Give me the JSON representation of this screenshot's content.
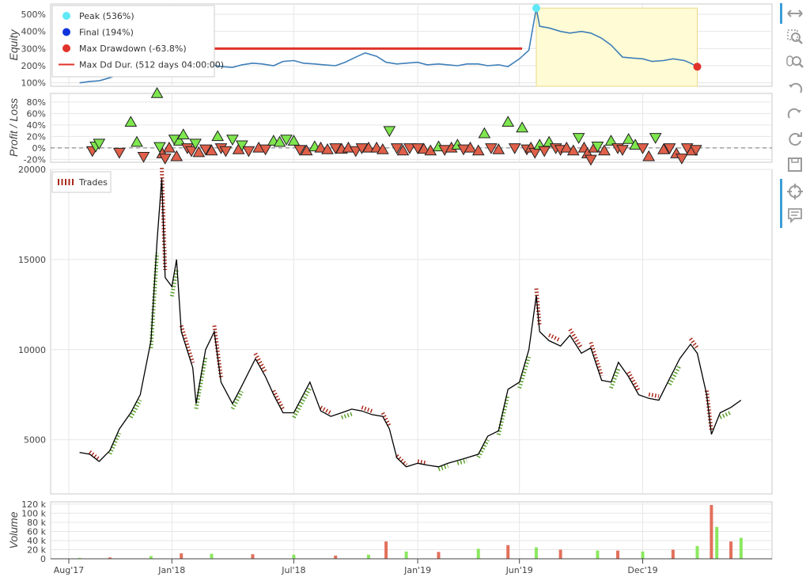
{
  "chart_data": [
    {
      "type": "line",
      "ylabel": "Equity",
      "yticks": [
        "500%",
        "400%",
        "300%",
        "200%",
        "100%"
      ],
      "ylim": [
        80,
        560
      ],
      "legend": [
        {
          "name": "Peak (536%)",
          "color": "#5fe8f5",
          "marker": "circle"
        },
        {
          "name": "Final (194%)",
          "color": "#1133dd",
          "marker": "circle"
        },
        {
          "name": "Max Drawdown (-63.8%)",
          "color": "#e0332b",
          "marker": "circle"
        },
        {
          "name": "Max Dd Dur. (512 days 04:00:00)",
          "color": "#e0332b",
          "marker": "line"
        }
      ],
      "legend_position": "top-left",
      "peak": {
        "date": "2019-06-26",
        "value": 536
      },
      "final": {
        "date": "2020-02-20",
        "value": 194
      },
      "max_drawdown_pct": -63.8,
      "max_dd_duration_level": 300,
      "max_dd_duration_range": [
        "2018-01-08",
        "2019-06-05"
      ],
      "drawdown_box": {
        "from": "2019-06-26",
        "to": "2020-02-20",
        "top": 536
      },
      "x": [
        "2017-08-17",
        "2017-09-01",
        "2017-09-15",
        "2017-10-01",
        "2017-10-15",
        "2017-11-01",
        "2017-11-15",
        "2017-12-01",
        "2017-12-15",
        "2018-01-01",
        "2018-01-15",
        "2018-02-01",
        "2018-02-15",
        "2018-03-01",
        "2018-03-15",
        "2018-04-01",
        "2018-04-15",
        "2018-05-01",
        "2018-05-15",
        "2018-06-01",
        "2018-06-15",
        "2018-07-01",
        "2018-07-15",
        "2018-08-01",
        "2018-08-15",
        "2018-09-01",
        "2018-09-15",
        "2018-10-01",
        "2018-10-15",
        "2018-11-01",
        "2018-11-15",
        "2018-12-01",
        "2018-12-15",
        "2019-01-01",
        "2019-01-15",
        "2019-02-01",
        "2019-02-15",
        "2019-03-01",
        "2019-03-15",
        "2019-04-01",
        "2019-04-15",
        "2019-05-01",
        "2019-05-15",
        "2019-06-01",
        "2019-06-15",
        "2019-06-26",
        "2019-07-01",
        "2019-07-15",
        "2019-08-01",
        "2019-08-15",
        "2019-09-01",
        "2019-09-15",
        "2019-10-01",
        "2019-10-15",
        "2019-11-01",
        "2019-11-15",
        "2019-12-01",
        "2019-12-15",
        "2020-01-01",
        "2020-01-15",
        "2020-02-01",
        "2020-02-10",
        "2020-02-20"
      ],
      "y": [
        100,
        108,
        112,
        130,
        150,
        170,
        180,
        200,
        215,
        225,
        230,
        220,
        200,
        205,
        195,
        190,
        205,
        215,
        210,
        200,
        225,
        230,
        215,
        210,
        205,
        200,
        220,
        250,
        275,
        255,
        220,
        210,
        215,
        220,
        205,
        210,
        205,
        200,
        210,
        210,
        200,
        205,
        195,
        240,
        290,
        536,
        430,
        420,
        400,
        390,
        400,
        390,
        360,
        320,
        250,
        245,
        240,
        225,
        230,
        240,
        230,
        215,
        194
      ]
    },
    {
      "type": "scatter",
      "ylabel": "Profit / Loss",
      "yticks": [
        "80%",
        "60%",
        "40%",
        "20%",
        "0%",
        "-20%"
      ],
      "ylim": [
        -25,
        95
      ],
      "markers": {
        "long": "triangle-up",
        "short": "triangle-down",
        "profit_color": "#7ee64e",
        "loss_color": "#e0604a"
      },
      "trades": [
        {
          "x": "2017-09-05",
          "pnl": -5,
          "dir": "short"
        },
        {
          "x": "2017-09-10",
          "pnl": 3,
          "dir": "short"
        },
        {
          "x": "2017-09-15",
          "pnl": 8,
          "dir": "short"
        },
        {
          "x": "2017-10-15",
          "pnl": -8,
          "dir": "short"
        },
        {
          "x": "2017-11-01",
          "pnl": 45,
          "dir": "long"
        },
        {
          "x": "2017-11-10",
          "pnl": 10,
          "dir": "long"
        },
        {
          "x": "2017-11-20",
          "pnl": -15,
          "dir": "short"
        },
        {
          "x": "2017-12-10",
          "pnl": 95,
          "dir": "long"
        },
        {
          "x": "2017-12-14",
          "pnl": 2,
          "dir": "short"
        },
        {
          "x": "2017-12-18",
          "pnl": -10,
          "dir": "long"
        },
        {
          "x": "2017-12-22",
          "pnl": -18,
          "dir": "short"
        },
        {
          "x": "2017-12-28",
          "pnl": 0,
          "dir": "long"
        },
        {
          "x": "2018-01-05",
          "pnl": 15,
          "dir": "short"
        },
        {
          "x": "2018-01-08",
          "pnl": -15,
          "dir": "long"
        },
        {
          "x": "2018-01-12",
          "pnl": 12,
          "dir": "long"
        },
        {
          "x": "2018-01-18",
          "pnl": 23,
          "dir": "long"
        },
        {
          "x": "2018-01-24",
          "pnl": 0,
          "dir": "short"
        },
        {
          "x": "2018-01-30",
          "pnl": -5,
          "dir": "short"
        },
        {
          "x": "2018-02-05",
          "pnl": 8,
          "dir": "short"
        },
        {
          "x": "2018-02-10",
          "pnl": -8,
          "dir": "long"
        },
        {
          "x": "2018-02-20",
          "pnl": -2,
          "dir": "short"
        },
        {
          "x": "2018-03-01",
          "pnl": -5,
          "dir": "long"
        },
        {
          "x": "2018-03-10",
          "pnl": 20,
          "dir": "long"
        },
        {
          "x": "2018-03-15",
          "pnl": 0,
          "dir": "short"
        },
        {
          "x": "2018-03-22",
          "pnl": -5,
          "dir": "short"
        },
        {
          "x": "2018-04-01",
          "pnl": 15,
          "dir": "short"
        },
        {
          "x": "2018-04-10",
          "pnl": -3,
          "dir": "long"
        },
        {
          "x": "2018-04-15",
          "pnl": 5,
          "dir": "short"
        },
        {
          "x": "2018-04-25",
          "pnl": -5,
          "dir": "short"
        },
        {
          "x": "2018-05-10",
          "pnl": 0,
          "dir": "long"
        },
        {
          "x": "2018-05-20",
          "pnl": -2,
          "dir": "short"
        },
        {
          "x": "2018-06-01",
          "pnl": 12,
          "dir": "long"
        },
        {
          "x": "2018-06-10",
          "pnl": 10,
          "dir": "long"
        },
        {
          "x": "2018-06-20",
          "pnl": 15,
          "dir": "short"
        },
        {
          "x": "2018-07-01",
          "pnl": 12,
          "dir": "long"
        },
        {
          "x": "2018-07-10",
          "pnl": -3,
          "dir": "short"
        },
        {
          "x": "2018-07-20",
          "pnl": -5,
          "dir": "long"
        },
        {
          "x": "2018-08-01",
          "pnl": 2,
          "dir": "long"
        },
        {
          "x": "2018-08-10",
          "pnl": 0,
          "dir": "long"
        },
        {
          "x": "2018-08-20",
          "pnl": -3,
          "dir": "long"
        },
        {
          "x": "2018-09-01",
          "pnl": 0,
          "dir": "short"
        },
        {
          "x": "2018-09-10",
          "pnl": -2,
          "dir": "long"
        },
        {
          "x": "2018-09-20",
          "pnl": 0,
          "dir": "long"
        },
        {
          "x": "2018-10-01",
          "pnl": -5,
          "dir": "short"
        },
        {
          "x": "2018-10-10",
          "pnl": 0,
          "dir": "short"
        },
        {
          "x": "2018-10-20",
          "pnl": 0,
          "dir": "long"
        },
        {
          "x": "2018-11-01",
          "pnl": 0,
          "dir": "long"
        },
        {
          "x": "2018-11-10",
          "pnl": -3,
          "dir": "long"
        },
        {
          "x": "2018-11-20",
          "pnl": 30,
          "dir": "short"
        },
        {
          "x": "2018-12-01",
          "pnl": 0,
          "dir": "short"
        },
        {
          "x": "2018-12-10",
          "pnl": -5,
          "dir": "long"
        },
        {
          "x": "2018-12-20",
          "pnl": 0,
          "dir": "short"
        },
        {
          "x": "2019-01-01",
          "pnl": 0,
          "dir": "short"
        },
        {
          "x": "2019-01-10",
          "pnl": -2,
          "dir": "long"
        },
        {
          "x": "2019-01-20",
          "pnl": -5,
          "dir": "long"
        },
        {
          "x": "2019-02-01",
          "pnl": 2,
          "dir": "long"
        },
        {
          "x": "2019-02-10",
          "pnl": -3,
          "dir": "short"
        },
        {
          "x": "2019-02-20",
          "pnl": 0,
          "dir": "long"
        },
        {
          "x": "2019-03-01",
          "pnl": 5,
          "dir": "long"
        },
        {
          "x": "2019-03-10",
          "pnl": -2,
          "dir": "short"
        },
        {
          "x": "2019-03-20",
          "pnl": 0,
          "dir": "long"
        },
        {
          "x": "2019-04-01",
          "pnl": -5,
          "dir": "long"
        },
        {
          "x": "2019-04-10",
          "pnl": 25,
          "dir": "long"
        },
        {
          "x": "2019-04-20",
          "pnl": 0,
          "dir": "short"
        },
        {
          "x": "2019-05-01",
          "pnl": -3,
          "dir": "long"
        },
        {
          "x": "2019-05-15",
          "pnl": 45,
          "dir": "long"
        },
        {
          "x": "2019-05-25",
          "pnl": 0,
          "dir": "short"
        },
        {
          "x": "2019-06-05",
          "pnl": 35,
          "dir": "long"
        },
        {
          "x": "2019-06-12",
          "pnl": -2,
          "dir": "short"
        },
        {
          "x": "2019-06-18",
          "pnl": 0,
          "dir": "long"
        },
        {
          "x": "2019-06-24",
          "pnl": -8,
          "dir": "short"
        },
        {
          "x": "2019-07-01",
          "pnl": 5,
          "dir": "long"
        },
        {
          "x": "2019-07-08",
          "pnl": -5,
          "dir": "short"
        },
        {
          "x": "2019-07-15",
          "pnl": 10,
          "dir": "long"
        },
        {
          "x": "2019-07-25",
          "pnl": 0,
          "dir": "short"
        },
        {
          "x": "2019-08-01",
          "pnl": -3,
          "dir": "short"
        },
        {
          "x": "2019-08-10",
          "pnl": 0,
          "dir": "long"
        },
        {
          "x": "2019-08-20",
          "pnl": -5,
          "dir": "long"
        },
        {
          "x": "2019-08-28",
          "pnl": 18,
          "dir": "short"
        },
        {
          "x": "2019-09-05",
          "pnl": 0,
          "dir": "long"
        },
        {
          "x": "2019-09-10",
          "pnl": -10,
          "dir": "long"
        },
        {
          "x": "2019-09-15",
          "pnl": -20,
          "dir": "short"
        },
        {
          "x": "2019-09-20",
          "pnl": 0,
          "dir": "long"
        },
        {
          "x": "2019-09-25",
          "pnl": 3,
          "dir": "short"
        },
        {
          "x": "2019-10-05",
          "pnl": -5,
          "dir": "long"
        },
        {
          "x": "2019-10-15",
          "pnl": 12,
          "dir": "long"
        },
        {
          "x": "2019-10-25",
          "pnl": 0,
          "dir": "short"
        },
        {
          "x": "2019-11-01",
          "pnl": -3,
          "dir": "short"
        },
        {
          "x": "2019-11-10",
          "pnl": 15,
          "dir": "long"
        },
        {
          "x": "2019-11-20",
          "pnl": 5,
          "dir": "long"
        },
        {
          "x": "2019-12-01",
          "pnl": 0,
          "dir": "short"
        },
        {
          "x": "2019-12-10",
          "pnl": -15,
          "dir": "long"
        },
        {
          "x": "2019-12-20",
          "pnl": 18,
          "dir": "short"
        },
        {
          "x": "2020-01-01",
          "pnl": -3,
          "dir": "long"
        },
        {
          "x": "2020-01-10",
          "pnl": 0,
          "dir": "short"
        },
        {
          "x": "2020-01-20",
          "pnl": -10,
          "dir": "long"
        },
        {
          "x": "2020-01-28",
          "pnl": -18,
          "dir": "short"
        },
        {
          "x": "2020-02-05",
          "pnl": 0,
          "dir": "short"
        },
        {
          "x": "2020-02-12",
          "pnl": -5,
          "dir": "long"
        },
        {
          "x": "2020-02-18",
          "pnl": -3,
          "dir": "short"
        }
      ]
    },
    {
      "type": "line",
      "title": "",
      "yticks": [
        "20000",
        "15000",
        "10000",
        "5000"
      ],
      "ylim": [
        2000,
        20000
      ],
      "legend": [
        {
          "name": "Trades",
          "color": "#aa2a1c"
        }
      ],
      "legend_position": "top-left",
      "trade_segment_colors": {
        "profit": "#5aa02c",
        "loss": "#aa2a1c"
      },
      "price_color": "#000000",
      "x": [
        "2017-08-17",
        "2017-09-01",
        "2017-09-15",
        "2017-10-01",
        "2017-10-15",
        "2017-11-01",
        "2017-11-15",
        "2017-12-01",
        "2017-12-10",
        "2017-12-17",
        "2017-12-22",
        "2018-01-01",
        "2018-01-08",
        "2018-01-15",
        "2018-02-01",
        "2018-02-06",
        "2018-02-20",
        "2018-03-05",
        "2018-03-15",
        "2018-04-01",
        "2018-04-15",
        "2018-05-05",
        "2018-05-20",
        "2018-06-01",
        "2018-06-15",
        "2018-07-01",
        "2018-07-25",
        "2018-08-10",
        "2018-08-25",
        "2018-09-10",
        "2018-09-25",
        "2018-10-10",
        "2018-10-25",
        "2018-11-10",
        "2018-11-20",
        "2018-12-01",
        "2018-12-15",
        "2019-01-01",
        "2019-01-15",
        "2019-02-01",
        "2019-02-15",
        "2019-03-01",
        "2019-03-15",
        "2019-04-01",
        "2019-04-15",
        "2019-05-01",
        "2019-05-15",
        "2019-06-01",
        "2019-06-15",
        "2019-06-26",
        "2019-07-01",
        "2019-07-15",
        "2019-08-01",
        "2019-08-15",
        "2019-09-01",
        "2019-09-15",
        "2019-10-01",
        "2019-10-15",
        "2019-10-26",
        "2019-11-10",
        "2019-11-25",
        "2019-12-10",
        "2019-12-25",
        "2020-01-10",
        "2020-01-25",
        "2020-02-10",
        "2020-02-20",
        "2020-03-05",
        "2020-03-12",
        "2020-03-25",
        "2020-04-10",
        "2020-04-25"
      ],
      "y": [
        4300,
        4200,
        3800,
        4400,
        5600,
        6500,
        7500,
        10500,
        16000,
        19500,
        14000,
        13500,
        15000,
        11000,
        9000,
        7000,
        10000,
        11000,
        8200,
        7000,
        8000,
        9500,
        8500,
        7500,
        6500,
        6500,
        8200,
        6600,
        6300,
        6500,
        6700,
        6600,
        6400,
        6300,
        5600,
        4000,
        3500,
        3700,
        3600,
        3500,
        3700,
        3850,
        4000,
        4200,
        5200,
        5500,
        7800,
        8200,
        10000,
        13000,
        11000,
        10500,
        10200,
        10800,
        9800,
        10100,
        8300,
        8200,
        9300,
        8500,
        7500,
        7300,
        7200,
        8400,
        9500,
        10300,
        9800,
        7500,
        5300,
        6500,
        6800,
        7200
      ]
    },
    {
      "type": "bar",
      "ylabel": "Volume",
      "yticks": [
        "120 k",
        "100 k",
        "80 k",
        "60 k",
        "40 k",
        "20 k",
        "0"
      ],
      "ylim": [
        0,
        125000
      ],
      "up_color": "#7ee64e",
      "down_color": "#e0604a",
      "x": [
        "2017-08-17",
        "2017-10-01",
        "2017-12-01",
        "2018-01-15",
        "2018-03-01",
        "2018-05-01",
        "2018-07-01",
        "2018-09-01",
        "2018-10-20",
        "2018-11-15",
        "2018-12-15",
        "2019-02-01",
        "2019-04-01",
        "2019-05-15",
        "2019-06-26",
        "2019-08-01",
        "2019-09-25",
        "2019-10-25",
        "2019-12-01",
        "2020-01-15",
        "2020-02-20",
        "2020-03-12",
        "2020-03-20",
        "2020-04-10",
        "2020-04-25"
      ],
      "values": [
        2000,
        3000,
        6000,
        12000,
        11000,
        10000,
        9000,
        7000,
        9000,
        38000,
        16000,
        15000,
        22000,
        30000,
        25000,
        20000,
        18000,
        18000,
        16000,
        20000,
        28000,
        118000,
        70000,
        38000,
        46000
      ]
    }
  ],
  "xaxis": {
    "ticks": [
      "Aug'17",
      "Jan'18",
      "Jul'18",
      "Jan'19",
      "Jun'19",
      "Dec'19"
    ],
    "tick_dates": [
      "2017-08-01",
      "2018-01-01",
      "2018-07-01",
      "2019-01-01",
      "2019-06-01",
      "2019-12-01"
    ],
    "range": [
      "2017-07-05",
      "2020-06-10"
    ]
  },
  "toolbar": {
    "tools": [
      "xpan-icon",
      "box-zoom-icon",
      "wheel-zoom-icon",
      "undo-icon",
      "redo-icon",
      "reset-icon",
      "save-icon",
      "crosshair-icon",
      "hover-icon"
    ]
  }
}
